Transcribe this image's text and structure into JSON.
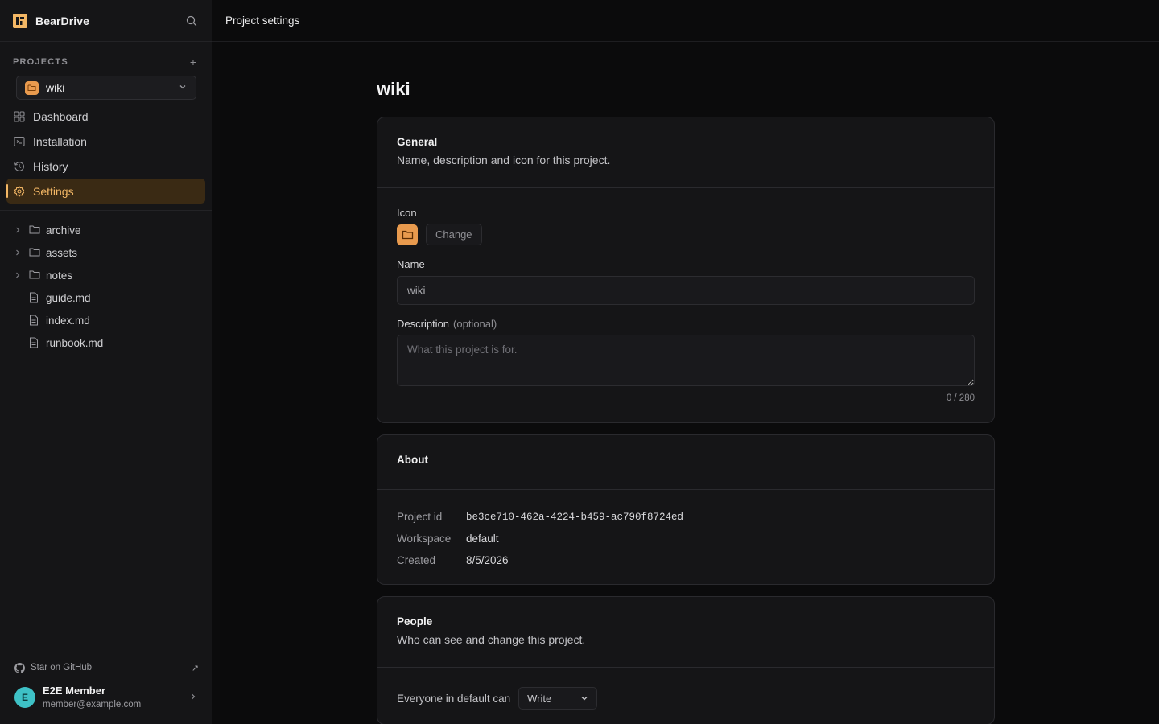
{
  "app": {
    "brand": "BearDrive"
  },
  "topbar": {
    "title": "Project settings"
  },
  "sidebar": {
    "projects_label": "PROJECTS",
    "add_label": "+",
    "current_project": "wiki",
    "nav": [
      {
        "label": "Dashboard",
        "icon": "dashboard-icon"
      },
      {
        "label": "Installation",
        "icon": "terminal-icon"
      },
      {
        "label": "History",
        "icon": "history-icon"
      },
      {
        "label": "Settings",
        "icon": "gear-icon",
        "active": true
      }
    ],
    "tree": [
      {
        "label": "archive",
        "type": "folder"
      },
      {
        "label": "assets",
        "type": "folder"
      },
      {
        "label": "notes",
        "type": "folder"
      },
      {
        "label": "guide.md",
        "type": "file"
      },
      {
        "label": "index.md",
        "type": "file"
      },
      {
        "label": "runbook.md",
        "type": "file"
      }
    ],
    "footer": {
      "github_label": "Star on GitHub",
      "external_glyph": "↗",
      "user_initial": "E",
      "user_name": "E2E Member",
      "user_email": "member@example.com"
    }
  },
  "main": {
    "page_title": "wiki",
    "general": {
      "title": "General",
      "description": "Name, description and icon for this project.",
      "icon_label": "Icon",
      "change_label": "Change",
      "name_label": "Name",
      "name_value": "wiki",
      "description_label": "Description",
      "optional_label": "(optional)",
      "description_placeholder": "What this project is for.",
      "counter": "0 / 280"
    },
    "about": {
      "title": "About",
      "rows": [
        {
          "key": "Project id",
          "value": "be3ce710-462a-4224-b459-ac790f8724ed"
        },
        {
          "key": "Workspace",
          "value": "default"
        },
        {
          "key": "Created",
          "value": "8/5/2026"
        }
      ]
    },
    "people": {
      "title": "People",
      "description": "Who can see and change this project.",
      "everyone_label": "Everyone in default can",
      "permission": "Write"
    }
  },
  "colors": {
    "accent": "#f3b765",
    "project_icon": "#e89a4e",
    "avatar": "#3ec1c6"
  }
}
